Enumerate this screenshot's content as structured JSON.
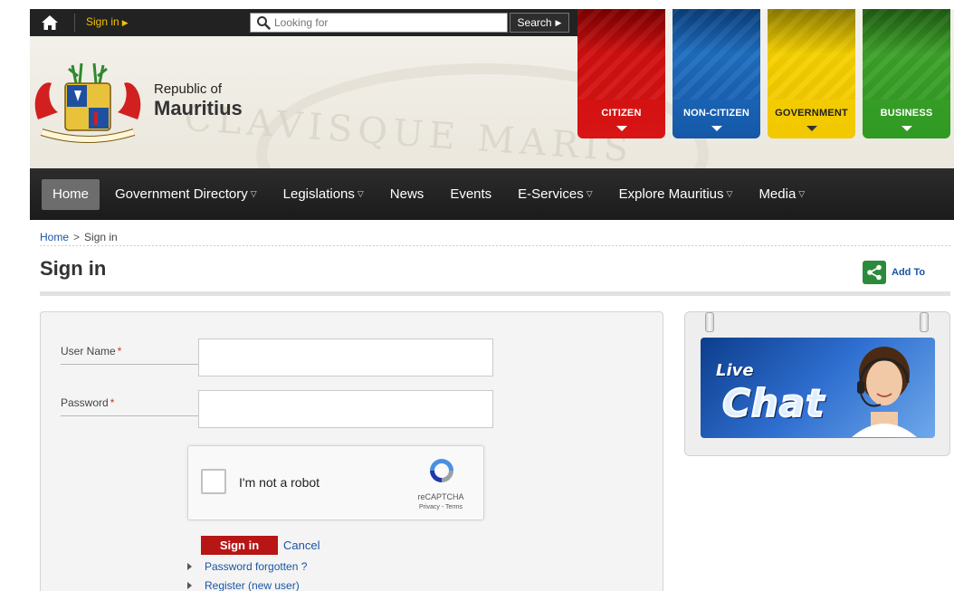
{
  "topbar": {
    "signin_label": "Sign in",
    "search_placeholder": "Looking for",
    "search_button": "Search"
  },
  "brand": {
    "line1": "Republic of",
    "line2": "Mauritius"
  },
  "categories": [
    {
      "label": "CITIZEN",
      "color": "#d01010"
    },
    {
      "label": "NON-CITIZEN",
      "color": "#1f6ec0"
    },
    {
      "label": "GOVERNMENT",
      "color": "#f5d000"
    },
    {
      "label": "BUSINESS",
      "color": "#3ea12a"
    }
  ],
  "nav": {
    "items": [
      {
        "label": "Home",
        "active": true,
        "dropdown": false
      },
      {
        "label": "Government Directory",
        "dropdown": true
      },
      {
        "label": "Legislations",
        "dropdown": true
      },
      {
        "label": "News",
        "dropdown": false
      },
      {
        "label": "Events",
        "dropdown": false
      },
      {
        "label": "E-Services",
        "dropdown": true
      },
      {
        "label": "Explore Mauritius",
        "dropdown": true
      },
      {
        "label": "Media",
        "dropdown": true
      }
    ]
  },
  "breadcrumb": {
    "home": "Home",
    "separator": ">",
    "current": "Sign in"
  },
  "page": {
    "title": "Sign in",
    "add_to": "Add To"
  },
  "form": {
    "username_label": "User Name",
    "password_label": "Password",
    "required_marker": "*",
    "username_value": "",
    "password_value": "",
    "recaptcha_text": "I'm not a robot",
    "recaptcha_brand": "reCAPTCHA",
    "recaptcha_links": "Privacy - Terms",
    "signin_button": "Sign in",
    "cancel_link": "Cancel",
    "password_forgotten": "Password forgotten ?",
    "register": "Register (new user)"
  },
  "chat": {
    "live": "Live",
    "word": "Chat"
  },
  "colors": {
    "accent_red": "#b81515",
    "link_blue": "#1a55a4",
    "nav_bg": "#222222"
  }
}
